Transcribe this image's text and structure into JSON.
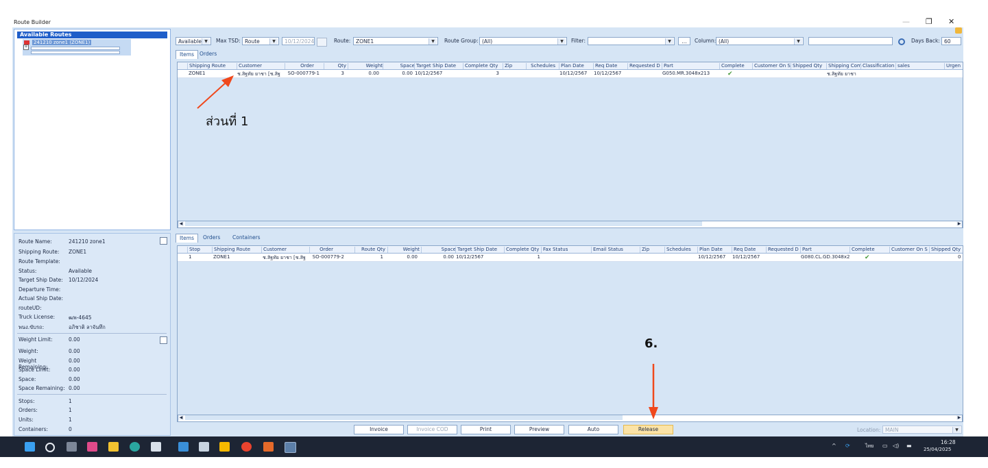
{
  "window": {
    "title": "Route Builder",
    "minimize": "—",
    "restore": "❐",
    "close": "✕"
  },
  "tree": {
    "header": "Available Routes",
    "node": "241210 zone1 (ZONE1)"
  },
  "toolbar": {
    "status_value": "Available",
    "max_tsd_label": "Max TSD:",
    "max_tsd_value": "Route",
    "date_value": "10/12/2024",
    "route_label": "Route:",
    "route_value": "ZONE1",
    "route_group_label": "Route Group:",
    "route_group_value": "(All)",
    "filter_label": "Filter:",
    "filter_value": "",
    "ellipsis": "...",
    "column_label": "Column:",
    "column_value": "(All)",
    "search_value": "",
    "days_back_label": "Days Back:",
    "days_back_value": "60"
  },
  "top_tabs": [
    "Items",
    "Orders"
  ],
  "top_grid": {
    "headers": [
      "Shipping Route",
      "Customer",
      "Order",
      "Qty",
      "Weight",
      "Space",
      "Target Ship Date",
      "Complete Qty",
      "Zip",
      "Schedules",
      "Plan Date",
      "Req Date",
      "Requested D",
      "Part",
      "Complete",
      "Customer On S",
      "Shipped Qty",
      "Shipping Com",
      "Classification",
      "sales",
      "Urgen"
    ],
    "row": {
      "shipping_route": "ZONE1",
      "customer": "ช.สิฐทัย ยาชา [ช.สิฐ",
      "order": "SO-000779-1",
      "qty": "3",
      "weight": "0.00",
      "space": "0.00",
      "target_ship_date": "10/12/2567",
      "complete_qty": "3",
      "plan_date": "10/12/2567",
      "req_date": "10/12/2567",
      "part": "G050.MR.3048x213",
      "complete": "✔",
      "shipping_com": "ช.สิฐทัย ยาชา"
    }
  },
  "bottom_tabs": [
    "Items",
    "Orders",
    "Containers"
  ],
  "bottom_grid": {
    "headers": [
      "Stop",
      "Shipping Route",
      "Customer",
      "Order",
      "Route Qty",
      "Weight",
      "Space",
      "Target Ship Date",
      "Complete Qty",
      "Fax Status",
      "Email Status",
      "Zip",
      "Schedules",
      "Plan Date",
      "Req Date",
      "Requested D",
      "Part",
      "Complete",
      "Customer On S",
      "Shipped Qty"
    ],
    "row": {
      "stop": "1",
      "shipping_route": "ZONE1",
      "customer": "ช.สิฐทัย ยาชา [ช.สิฐ",
      "order": "SO-000779-2",
      "route_qty": "1",
      "weight": "0.00",
      "space": "0.00",
      "target_ship_date": "10/12/2567",
      "complete_qty": "1",
      "plan_date": "10/12/2567",
      "req_date": "10/12/2567",
      "part": "G080.CL.GD.3048x2",
      "complete": "✔",
      "shipped_qty": "0"
    }
  },
  "info": {
    "route_name": {
      "k": "Route Name:",
      "v": "241210 zone1"
    },
    "shipping_route": {
      "k": "Shipping Route:",
      "v": "ZONE1"
    },
    "route_template": {
      "k": "Route Template:",
      "v": ""
    },
    "status": {
      "k": "Status:",
      "v": "Available"
    },
    "target_ship_date": {
      "k": "Target Ship Date:",
      "v": "10/12/2024"
    },
    "departure_time": {
      "k": "Departure Time:",
      "v": ""
    },
    "actual_ship_date": {
      "k": "Actual Ship Date:",
      "v": ""
    },
    "route_ud": {
      "k": "routeUD:",
      "v": ""
    },
    "truck_license": {
      "k": "Truck License:",
      "v": "ฒพ-4645"
    },
    "driver": {
      "k": "พนง.ขับรถ:",
      "v": "อภิชาติ ลาจันทึก"
    },
    "weight_limit": {
      "k": "Weight Limit:",
      "v": "0.00"
    },
    "weight": {
      "k": "Weight:",
      "v": "0.00"
    },
    "weight_remaining": {
      "k": "Weight Remaining:",
      "v": "0.00"
    },
    "space_limit": {
      "k": "Space Limit:",
      "v": "0.00"
    },
    "space": {
      "k": "Space:",
      "v": "0.00"
    },
    "space_remaining": {
      "k": "Space Remaining:",
      "v": "0.00"
    },
    "stops": {
      "k": "Stops:",
      "v": "1"
    },
    "orders": {
      "k": "Orders:",
      "v": "1"
    },
    "units": {
      "k": "Units:",
      "v": "1"
    },
    "containers": {
      "k": "Containers:",
      "v": "0"
    }
  },
  "buttons": {
    "invoice": "Invoice",
    "invoice_cod": "Invoice COD",
    "print": "Print",
    "preview": "Preview",
    "auto": "Auto",
    "release": "Release",
    "location_label": "Location:",
    "location_value": "MAIN"
  },
  "annotations": {
    "part1": "ส่วนที่ 1",
    "step6": "6."
  },
  "taskbar": {
    "lang": "ไทย",
    "time": "16:28",
    "date": "25/04/2025"
  },
  "colors": {
    "accent": "#1f5ec9",
    "arrow": "#f0481c",
    "release": "#fbe3a6"
  }
}
